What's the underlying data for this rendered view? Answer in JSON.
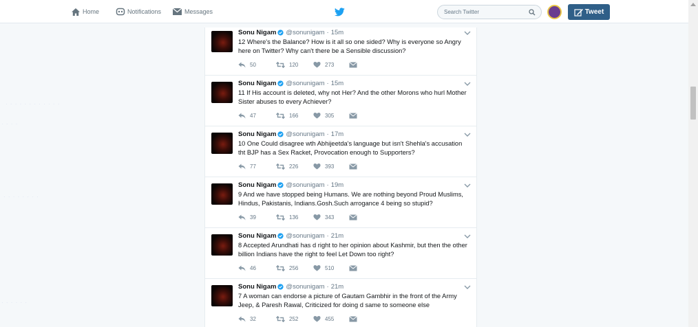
{
  "nav": {
    "home": "Home",
    "notifications": "Notifications",
    "messages": "Messages"
  },
  "search": {
    "placeholder": "Search Twitter"
  },
  "tweet_button": "Tweet",
  "colors": {
    "twitter_blue": "#1da1f2",
    "tweet_button": "#2f5f88",
    "muted": "#657786"
  },
  "icons": [
    "home-icon",
    "notifications-icon",
    "messages-icon",
    "twitter-bird-icon",
    "search-icon",
    "compose-icon",
    "verified-icon",
    "chevron-down-icon",
    "reply-icon",
    "retweet-icon",
    "heart-icon",
    "direct-message-icon"
  ],
  "tweets": [
    {
      "name": "Sonu Nigam",
      "handle": "@sonunigam",
      "sep": "·",
      "time": "15m",
      "text": "12 Where's the Balance? How is it all so one sided? Why is everyone so Angry here on Twitter? Why can't there be a Sensible discussion?",
      "replies": "50",
      "retweets": "120",
      "likes": "273"
    },
    {
      "name": "Sonu Nigam",
      "handle": "@sonunigam",
      "sep": "·",
      "time": "15m",
      "text": "11 If His account is deleted, why not Her? And the other Morons who hurl Mother Sister abuses to every Achiever?",
      "replies": "47",
      "retweets": "166",
      "likes": "305"
    },
    {
      "name": "Sonu Nigam",
      "handle": "@sonunigam",
      "sep": "·",
      "time": "17m",
      "text": "10 One Could disagree wth Abhijeetda's language but isn't Shehla's accusation tht BJP has a Sex Racket, Provocation enough to Supporters?",
      "replies": "77",
      "retweets": "226",
      "likes": "393"
    },
    {
      "name": "Sonu Nigam",
      "handle": "@sonunigam",
      "sep": "·",
      "time": "19m",
      "text": "9 And we have stopped being Humans. We are nothing beyond Proud Muslims, Hindus, Pakistanis, Indians.Gosh.Such arrogance 4 being so stupid?",
      "replies": "39",
      "retweets": "136",
      "likes": "343"
    },
    {
      "name": "Sonu Nigam",
      "handle": "@sonunigam",
      "sep": "·",
      "time": "21m",
      "text": "8 Accepted Arundhati has d right to her opinion about Kashmir, but then the other billion Indians have the right to feel Let Down too right?",
      "replies": "46",
      "retweets": "256",
      "likes": "510"
    },
    {
      "name": "Sonu Nigam",
      "handle": "@sonunigam",
      "sep": "·",
      "time": "21m",
      "text": "7 A woman can endorse a picture of Gautam Gambhir in the front of the Army Jeep, & Paresh Rawal, Criticized for doing d same to someone else",
      "replies": "32",
      "retweets": "252",
      "likes": "455"
    }
  ]
}
